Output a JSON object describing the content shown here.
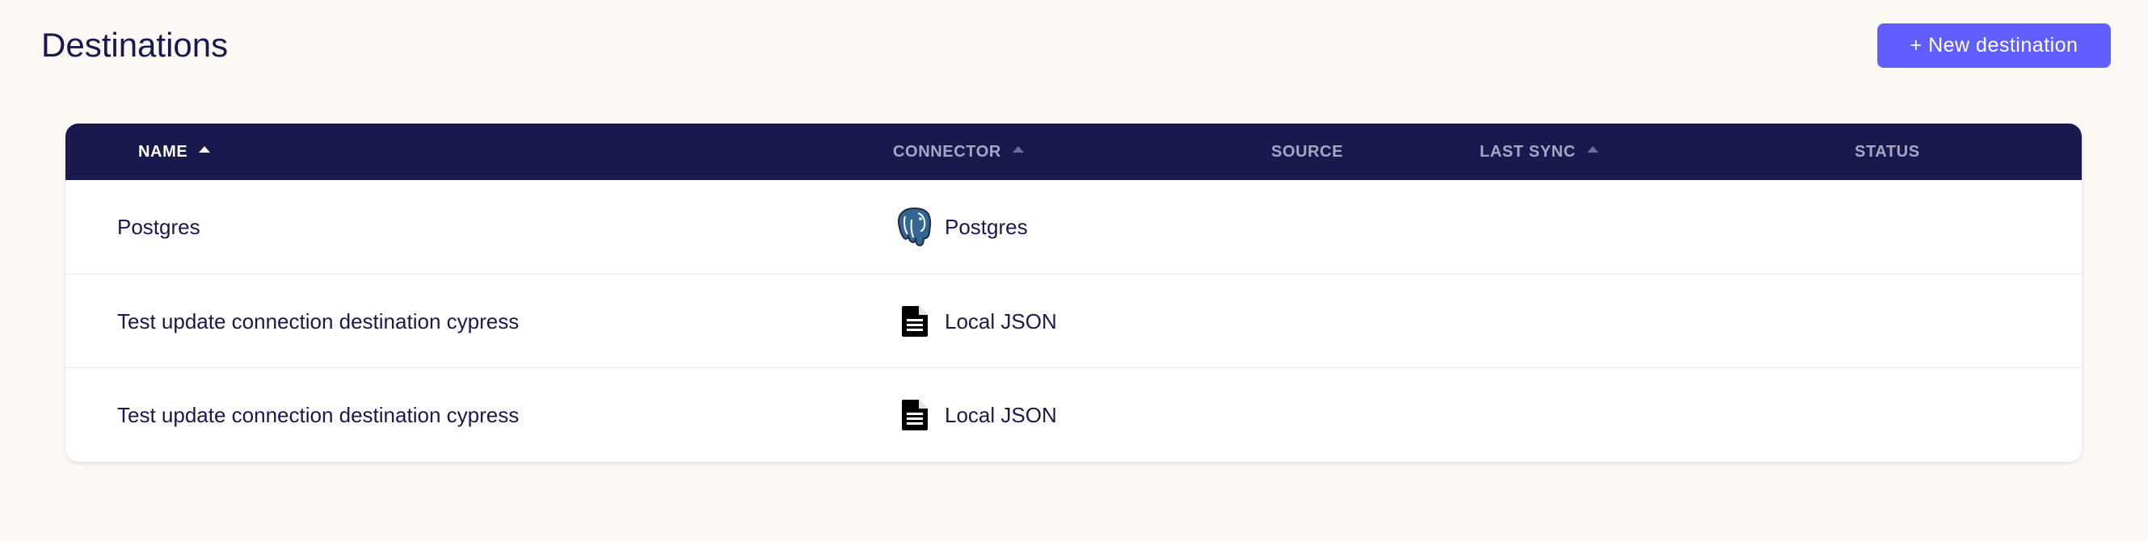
{
  "header": {
    "title": "Destinations",
    "new_button_label": "+ New destination"
  },
  "table": {
    "columns": [
      {
        "key": "name",
        "label": "NAME",
        "sortable": true,
        "active": true
      },
      {
        "key": "connector",
        "label": "CONNECTOR",
        "sortable": true,
        "active": false
      },
      {
        "key": "source",
        "label": "SOURCE",
        "sortable": false,
        "active": false
      },
      {
        "key": "last_sync",
        "label": "LAST SYNC",
        "sortable": true,
        "active": false
      },
      {
        "key": "status",
        "label": "STATUS",
        "sortable": false,
        "active": false
      }
    ],
    "rows": [
      {
        "name": "Postgres",
        "connector": "Postgres",
        "connector_icon": "postgres-elephant-icon",
        "source": "",
        "last_sync": "",
        "status": ""
      },
      {
        "name": "Test update connection destination cypress",
        "connector": "Local JSON",
        "connector_icon": "document-icon",
        "source": "",
        "last_sync": "",
        "status": ""
      },
      {
        "name": "Test update connection destination cypress",
        "connector": "Local JSON",
        "connector_icon": "document-icon",
        "source": "",
        "last_sync": "",
        "status": ""
      }
    ]
  },
  "colors": {
    "background": "#fcf9f5",
    "header_bg": "#1a194d",
    "accent": "#615eff",
    "text": "#1a194d"
  }
}
